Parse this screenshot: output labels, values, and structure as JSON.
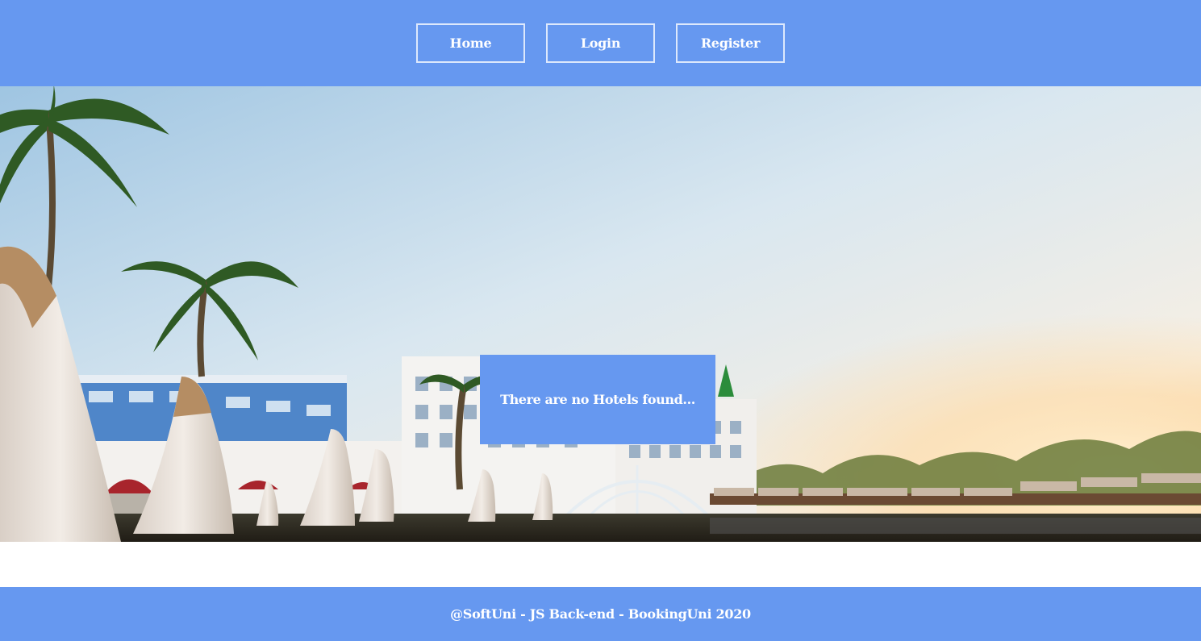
{
  "nav": {
    "items": [
      {
        "label": "Home"
      },
      {
        "label": "Login"
      },
      {
        "label": "Register"
      }
    ]
  },
  "main": {
    "message": "There are no Hotels found..."
  },
  "footer": {
    "text": "@SoftUni - JS Back-end - BookingUni 2020"
  },
  "colors": {
    "brand": "#6698f0",
    "text": "#ffffff"
  }
}
